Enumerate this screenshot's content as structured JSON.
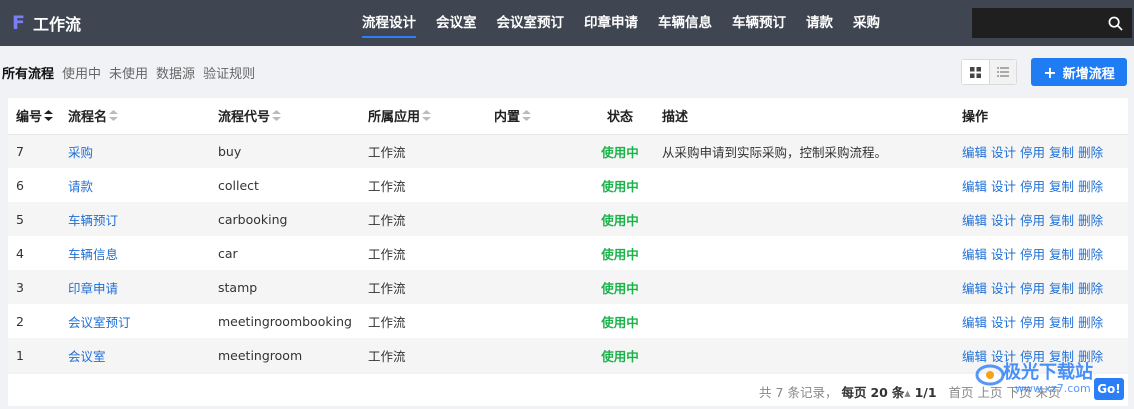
{
  "app": {
    "logo_letter": "F",
    "title": "工作流"
  },
  "nav": [
    {
      "label": "流程设计",
      "active": true
    },
    {
      "label": "会议室",
      "active": false
    },
    {
      "label": "会议室预订",
      "active": false
    },
    {
      "label": "印章申请",
      "active": false
    },
    {
      "label": "车辆信息",
      "active": false
    },
    {
      "label": "车辆预订",
      "active": false
    },
    {
      "label": "请款",
      "active": false
    },
    {
      "label": "采购",
      "active": false
    }
  ],
  "search": {
    "value": "",
    "icon": "search-icon"
  },
  "subtabs": [
    {
      "label": "所有流程",
      "active": true
    },
    {
      "label": "使用中",
      "active": false
    },
    {
      "label": "未使用",
      "active": false
    },
    {
      "label": "数据源",
      "active": false
    },
    {
      "label": "验证规则",
      "active": false
    }
  ],
  "toolbar": {
    "new_label": "新增流程",
    "grid_icon": "grid-view-icon",
    "list_icon": "list-view-icon"
  },
  "table": {
    "headers": [
      "编号",
      "流程名",
      "流程代号",
      "所属应用",
      "内置",
      "状态",
      "描述",
      "操作"
    ],
    "rows": [
      {
        "id": "7",
        "name": "采购",
        "code": "buy",
        "app": "工作流",
        "builtin": "",
        "status": "使用中",
        "desc": "从采购申请到实际采购，控制采购流程。"
      },
      {
        "id": "6",
        "name": "请款",
        "code": "collect",
        "app": "工作流",
        "builtin": "",
        "status": "使用中",
        "desc": ""
      },
      {
        "id": "5",
        "name": "车辆预订",
        "code": "carbooking",
        "app": "工作流",
        "builtin": "",
        "status": "使用中",
        "desc": ""
      },
      {
        "id": "4",
        "name": "车辆信息",
        "code": "car",
        "app": "工作流",
        "builtin": "",
        "status": "使用中",
        "desc": ""
      },
      {
        "id": "3",
        "name": "印章申请",
        "code": "stamp",
        "app": "工作流",
        "builtin": "",
        "status": "使用中",
        "desc": ""
      },
      {
        "id": "2",
        "name": "会议室预订",
        "code": "meetingroombooking",
        "app": "工作流",
        "builtin": "",
        "status": "使用中",
        "desc": ""
      },
      {
        "id": "1",
        "name": "会议室",
        "code": "meetingroom",
        "app": "工作流",
        "builtin": "",
        "status": "使用中",
        "desc": ""
      }
    ],
    "actions": [
      "编辑",
      "设计",
      "停用",
      "复制",
      "删除"
    ]
  },
  "pager": {
    "prefix": "共",
    "total": "7",
    "records_suffix": "条记录，",
    "per_page_label": "每页",
    "per_page": "20",
    "per_page_suffix": "条",
    "page_info": "1/1",
    "first": "首页",
    "prev": "上页",
    "next": "下页",
    "last": "末页"
  },
  "watermark": {
    "text": "极光下载站",
    "url": "www.xz7.com",
    "badge": "Go!"
  },
  "colors": {
    "nav_bg": "#3f4652",
    "accent": "#1f7cf2",
    "link": "#1f6fd6",
    "status_ok": "#1ab34a"
  }
}
